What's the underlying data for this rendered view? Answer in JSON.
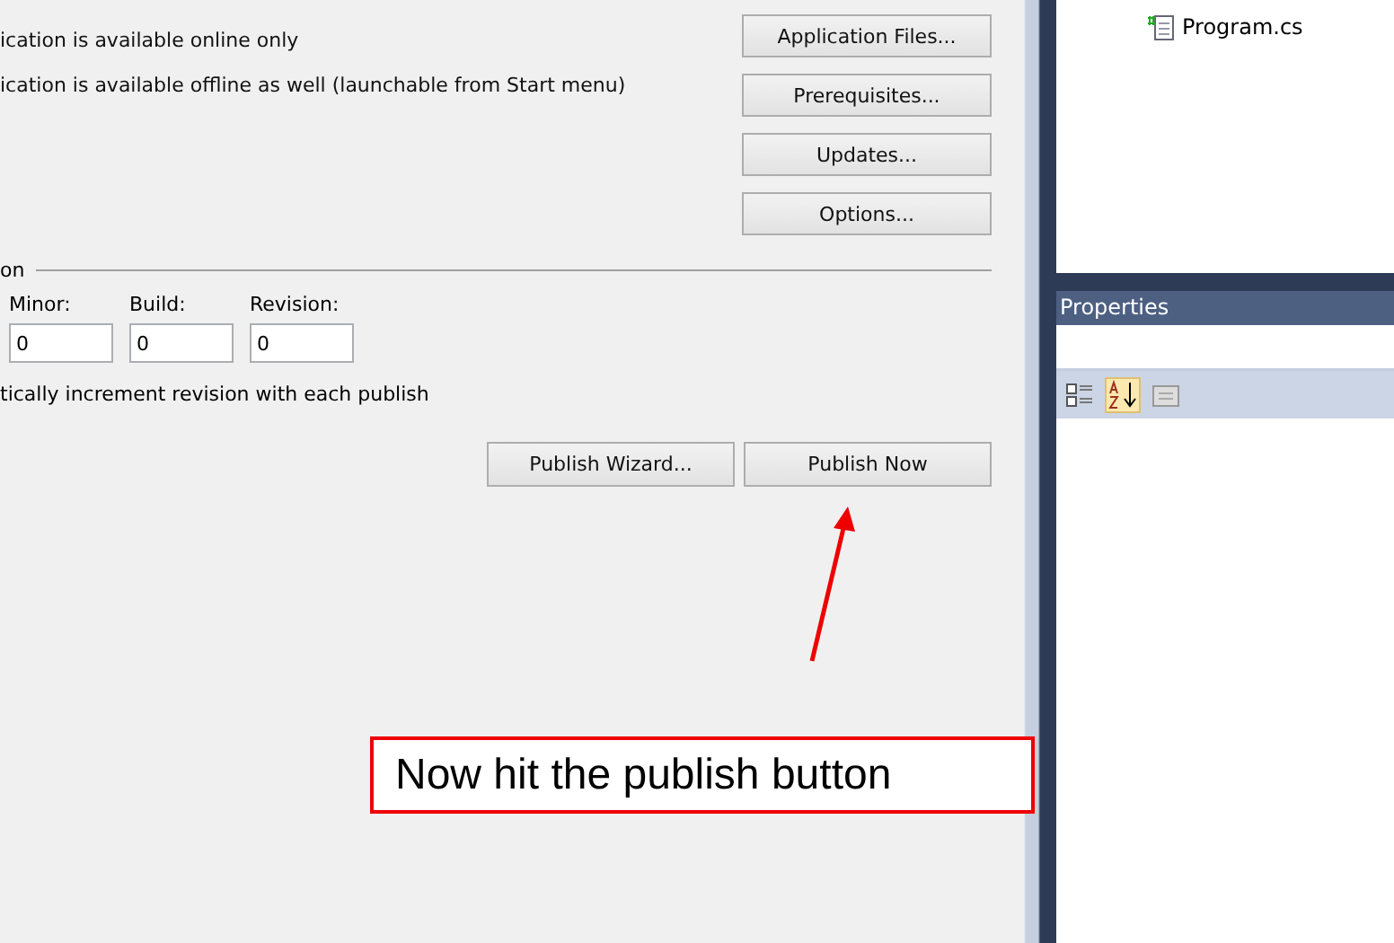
{
  "deployment": {
    "options": [
      "ication is available online only",
      "ication is available offline as well (launchable from Start menu)"
    ],
    "buttons": [
      "Application Files...",
      "Prerequisites...",
      "Updates...",
      "Options..."
    ]
  },
  "version": {
    "header": "on",
    "fields": [
      {
        "label": "Minor:",
        "value": "0"
      },
      {
        "label": "Build:",
        "value": "0"
      },
      {
        "label": "Revision:",
        "value": "0"
      }
    ],
    "auto_increment": "tically increment revision with each publish"
  },
  "actions": [
    "Publish Wizard...",
    "Publish Now"
  ],
  "solution_explorer": {
    "items": [
      {
        "label": "Program.cs"
      }
    ]
  },
  "properties": {
    "title": "Properties"
  },
  "annotation": {
    "text": "Now hit the publish button"
  }
}
